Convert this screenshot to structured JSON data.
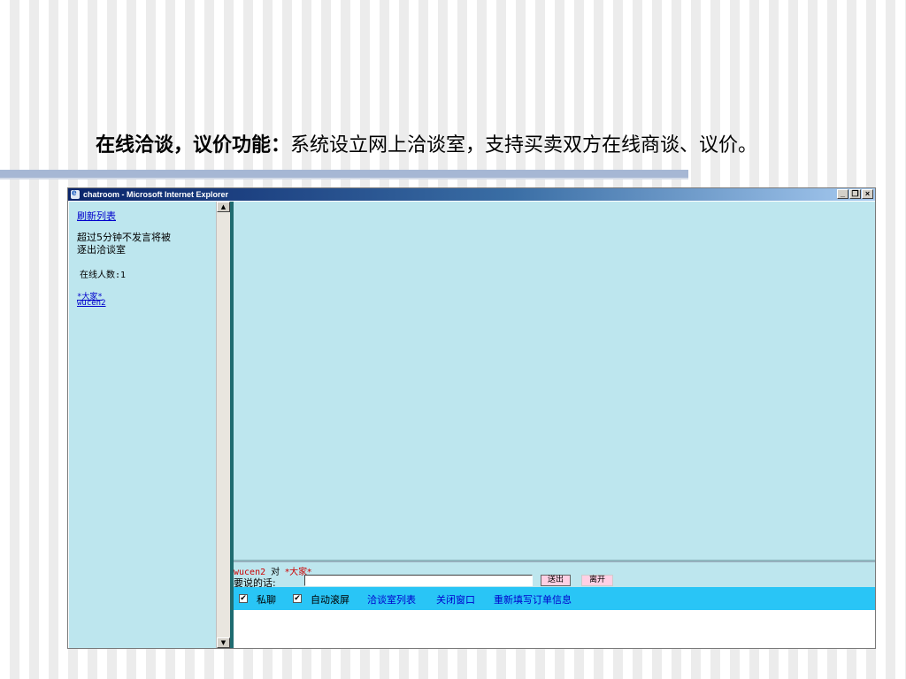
{
  "slide": {
    "title_bold": "在线洽谈，议价功能：",
    "title_rest": "系统设立网上洽谈室，支持买卖双方在线商谈、议价。"
  },
  "window": {
    "title": "chatroom - Microsoft Internet Explorer",
    "controls": {
      "minimize": "_",
      "restore": "❐",
      "close": "×"
    }
  },
  "left_frame": {
    "refresh_link": "刷新列表",
    "notice_line1": "超过5分钟不发言将被",
    "notice_line2": "逐出洽谈室",
    "online_count": "在线人数:1",
    "users": [
      "*大家*",
      "wucen2"
    ]
  },
  "input_area": {
    "from_user": "wucen2",
    "to_label": "对",
    "to_target": "*大家*",
    "say_label": "要说的话:",
    "message_value": "",
    "send_button": "送出",
    "leave_button": "离开"
  },
  "toolbar": {
    "private_checked": "✔",
    "private_label": "私聊",
    "autoscroll_checked": "✔",
    "autoscroll_label": "自动滚屏",
    "links": [
      "洽谈室列表",
      "关闭窗口",
      "重新填写订单信息"
    ]
  },
  "colors": {
    "frame_bg": "#bde6ee",
    "toolbar_bg": "#29c5f6",
    "title_gradient_start": "#0a246a"
  }
}
